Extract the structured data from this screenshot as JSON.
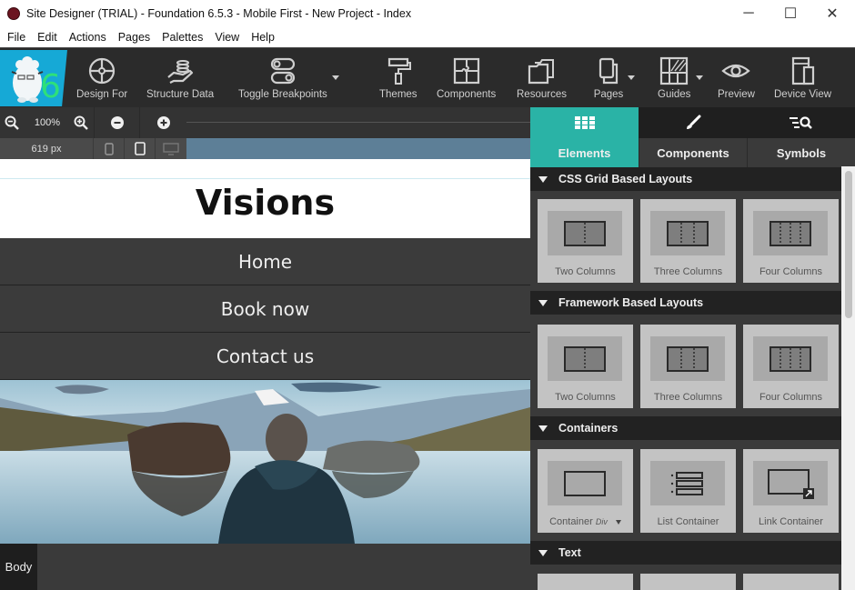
{
  "window": {
    "title": "Site Designer (TRIAL) - Foundation 6.5.3 - Mobile First - New Project - Index",
    "controls": {
      "minimize": "─",
      "maximize": "☐",
      "close": "✕"
    }
  },
  "menu": [
    "File",
    "Edit",
    "Actions",
    "Pages",
    "Palettes",
    "View",
    "Help"
  ],
  "toolbar": {
    "logo_label": "6",
    "tools": [
      {
        "label": "Design For",
        "icon": "crosshair-icon"
      },
      {
        "label": "Structure Data",
        "icon": "hand-stack-icon"
      },
      {
        "label": "Toggle Breakpoints",
        "icon": "toggle-icon",
        "dropdown": true
      },
      {
        "label": "Themes",
        "icon": "paint-roller-icon"
      },
      {
        "label": "Components",
        "icon": "puzzle-icon"
      },
      {
        "label": "Resources",
        "icon": "folders-icon"
      },
      {
        "label": "Pages",
        "icon": "pages-icon",
        "dropdown": true
      },
      {
        "label": "Guides",
        "icon": "guides-grid-icon",
        "dropdown": true
      },
      {
        "label": "Preview",
        "icon": "eye-icon"
      },
      {
        "label": "Device View",
        "icon": "devices-icon"
      }
    ]
  },
  "zoom": {
    "level": "100%",
    "width_readout": "619 px"
  },
  "canvas": {
    "site_title": "Visions",
    "nav": [
      "Home",
      "Book now",
      "Contact us"
    ],
    "status_tag": "Body"
  },
  "panel": {
    "tabs": [
      {
        "label": "Elements",
        "icon": "grid-icon",
        "active": true
      },
      {
        "label": "Components",
        "icon": "brush-icon",
        "active": false
      },
      {
        "label": "Symbols",
        "icon": "list-search-icon",
        "active": false
      }
    ],
    "sections": [
      {
        "title": "CSS Grid Based Layouts",
        "items": [
          "Two Columns",
          "Three Columns",
          "Four Columns"
        ]
      },
      {
        "title": "Framework Based Layouts",
        "items": [
          "Two Columns",
          "Three Columns",
          "Four Columns"
        ]
      },
      {
        "title": "Containers",
        "items": [
          "Container",
          "List Container",
          "Link Container"
        ],
        "container_subtype": "Div"
      },
      {
        "title": "Text",
        "items": []
      }
    ]
  }
}
